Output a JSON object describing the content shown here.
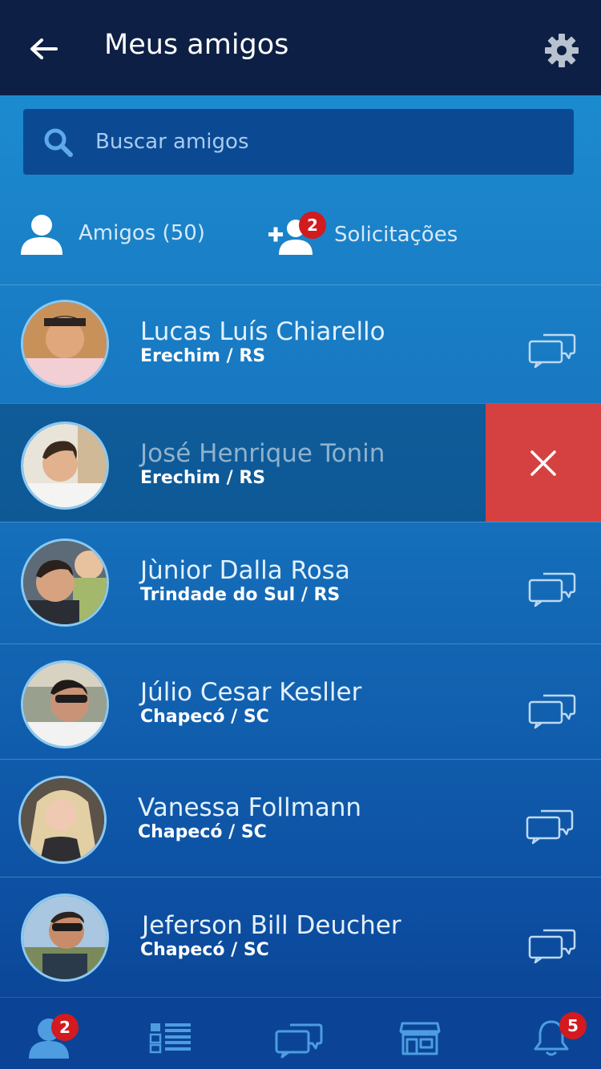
{
  "header": {
    "title": "Meus amigos",
    "back_icon": "arrow-left-icon",
    "settings_icon": "gear-icon"
  },
  "search": {
    "placeholder": "Buscar amigos",
    "value": "",
    "icon": "search-icon"
  },
  "tabs": {
    "friends_label": "Amigos (50)",
    "requests_label": "Solicitações",
    "requests_badge": "2"
  },
  "friends": [
    {
      "name": "Lucas Luís Chiarello",
      "location": "Erechim / RS",
      "swiped": false
    },
    {
      "name": "José Henrique Tonin",
      "location": "Erechim / RS",
      "swiped": true
    },
    {
      "name": "Jùnior Dalla Rosa",
      "location": "Trindade do Sul / RS",
      "swiped": false
    },
    {
      "name": "Júlio Cesar Kesller",
      "location": "Chapecó / SC",
      "swiped": false
    },
    {
      "name": "Vanessa Follmann",
      "location": "Chapecó / SC",
      "swiped": false
    },
    {
      "name": "Jeferson Bill Deucher",
      "location": "Chapecó / SC",
      "swiped": false
    }
  ],
  "bottom_nav": {
    "friends_badge": "2",
    "notifications_badge": "5",
    "items": [
      "friends-icon",
      "feed-list-icon",
      "chat-icon",
      "store-icon",
      "bell-icon"
    ]
  },
  "colors": {
    "topbar": "#0d1f44",
    "delete": "#d54141",
    "badge": "#d21a1f"
  }
}
